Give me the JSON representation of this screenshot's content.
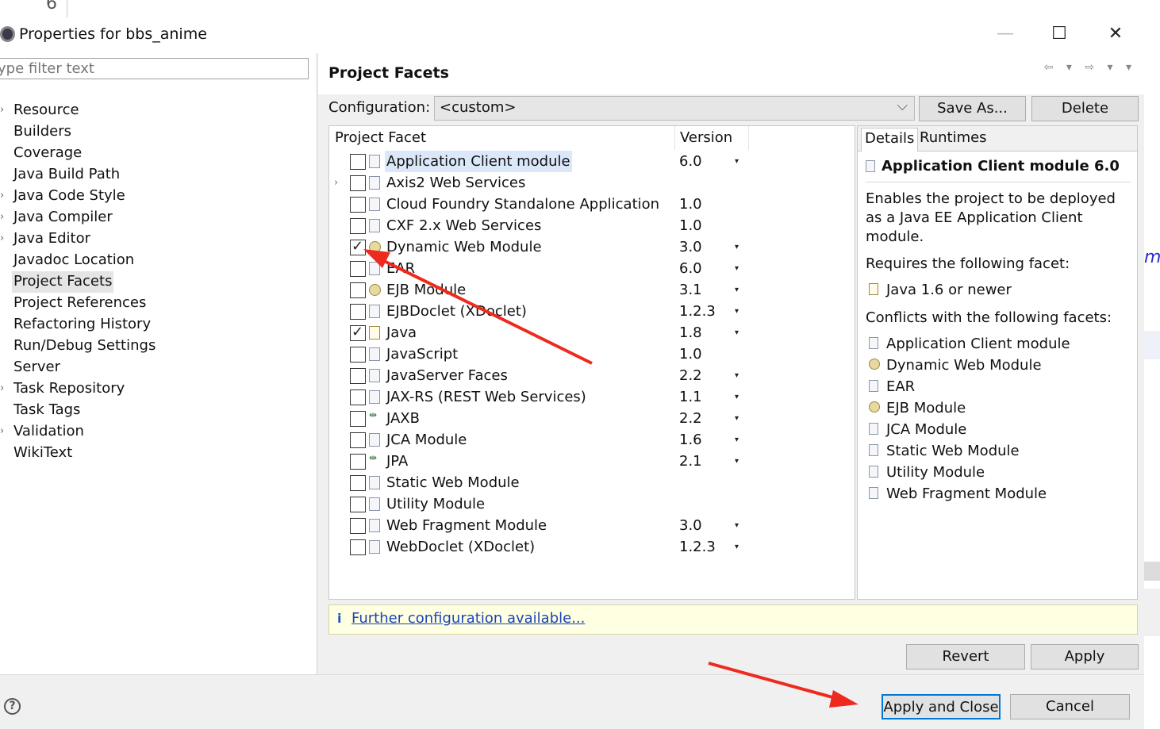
{
  "background": {
    "editor_line_number": "6",
    "editor_fragment": "mp"
  },
  "dialog": {
    "title": "Properties for bbs_anime",
    "minimize_glyph": "—",
    "maximize_glyph": "☐",
    "close_glyph": "✕"
  },
  "filter": {
    "placeholder": "type filter text",
    "shown_text": "ype filter text"
  },
  "tree": {
    "items": [
      {
        "label": "Resource",
        "expandable": true
      },
      {
        "label": "Builders",
        "expandable": false
      },
      {
        "label": "Coverage",
        "expandable": false
      },
      {
        "label": "Java Build Path",
        "expandable": false
      },
      {
        "label": "Java Code Style",
        "expandable": true
      },
      {
        "label": "Java Compiler",
        "expandable": true
      },
      {
        "label": "Java Editor",
        "expandable": true
      },
      {
        "label": "Javadoc Location",
        "expandable": false
      },
      {
        "label": "Project Facets",
        "expandable": false,
        "selected": true
      },
      {
        "label": "Project References",
        "expandable": false
      },
      {
        "label": "Refactoring History",
        "expandable": false
      },
      {
        "label": "Run/Debug Settings",
        "expandable": false
      },
      {
        "label": "Server",
        "expandable": false
      },
      {
        "label": "Task Repository",
        "expandable": true
      },
      {
        "label": "Task Tags",
        "expandable": false
      },
      {
        "label": "Validation",
        "expandable": true
      },
      {
        "label": "WikiText",
        "expandable": false
      }
    ]
  },
  "page": {
    "title": "Project Facets",
    "nav_icons": "⇦ ▾ ⇨ ▾ ▾",
    "configuration_label": "Configuration:",
    "configuration_value": "<custom>",
    "save_as_label": "Save As...",
    "delete_label": "Delete"
  },
  "facets": {
    "header_facet": "Project Facet",
    "header_version": "Version",
    "rows": [
      {
        "name": "Application Client module",
        "version": "6.0",
        "checked": false,
        "dropdown": true,
        "selected": true,
        "icon": "page"
      },
      {
        "name": "Axis2 Web Services",
        "version": "",
        "checked": false,
        "dropdown": false,
        "expandable": true,
        "icon": "page"
      },
      {
        "name": "Cloud Foundry Standalone Application",
        "version": "1.0",
        "checked": false,
        "dropdown": false,
        "icon": "page"
      },
      {
        "name": "CXF 2.x Web Services",
        "version": "1.0",
        "checked": false,
        "dropdown": false,
        "icon": "page"
      },
      {
        "name": "Dynamic Web Module",
        "version": "3.0",
        "checked": true,
        "dropdown": true,
        "icon": "globe"
      },
      {
        "name": "EAR",
        "version": "6.0",
        "checked": false,
        "dropdown": true,
        "icon": "page"
      },
      {
        "name": "EJB Module",
        "version": "3.1",
        "checked": false,
        "dropdown": true,
        "icon": "globe"
      },
      {
        "name": "EJBDoclet (XDoclet)",
        "version": "1.2.3",
        "checked": false,
        "dropdown": true,
        "icon": "page"
      },
      {
        "name": "Java",
        "version": "1.8",
        "checked": true,
        "dropdown": true,
        "icon": "java"
      },
      {
        "name": "JavaScript",
        "version": "1.0",
        "checked": false,
        "dropdown": false,
        "icon": "page"
      },
      {
        "name": "JavaServer Faces",
        "version": "2.2",
        "checked": false,
        "dropdown": true,
        "icon": "page"
      },
      {
        "name": "JAX-RS (REST Web Services)",
        "version": "1.1",
        "checked": false,
        "dropdown": true,
        "icon": "page"
      },
      {
        "name": "JAXB",
        "version": "2.2",
        "checked": false,
        "dropdown": true,
        "icon": "jaxb"
      },
      {
        "name": "JCA Module",
        "version": "1.6",
        "checked": false,
        "dropdown": true,
        "icon": "page"
      },
      {
        "name": "JPA",
        "version": "2.1",
        "checked": false,
        "dropdown": true,
        "icon": "jaxb"
      },
      {
        "name": "Static Web Module",
        "version": "",
        "checked": false,
        "dropdown": false,
        "icon": "page"
      },
      {
        "name": "Utility Module",
        "version": "",
        "checked": false,
        "dropdown": false,
        "icon": "page"
      },
      {
        "name": "Web Fragment Module",
        "version": "3.0",
        "checked": false,
        "dropdown": true,
        "icon": "page"
      },
      {
        "name": "WebDoclet (XDoclet)",
        "version": "1.2.3",
        "checked": false,
        "dropdown": true,
        "icon": "page"
      }
    ]
  },
  "details": {
    "tab_details": "Details",
    "tab_runtimes": "Runtimes",
    "title": "Application Client module 6.0",
    "description": "Enables the project to be deployed as a Java EE Application Client module.",
    "requires_label": "Requires the following facet:",
    "requires": [
      {
        "name": "Java 1.6 or newer",
        "icon": "java"
      }
    ],
    "conflicts_label": "Conflicts with the following facets:",
    "conflicts": [
      {
        "name": "Application Client module",
        "icon": "page"
      },
      {
        "name": "Dynamic Web Module",
        "icon": "globe"
      },
      {
        "name": "EAR",
        "icon": "page"
      },
      {
        "name": "EJB Module",
        "icon": "globe"
      },
      {
        "name": "JCA Module",
        "icon": "page"
      },
      {
        "name": "Static Web Module",
        "icon": "page"
      },
      {
        "name": "Utility Module",
        "icon": "page"
      },
      {
        "name": "Web Fragment Module",
        "icon": "page"
      }
    ]
  },
  "info": {
    "icon": "i",
    "link": "Further configuration available..."
  },
  "buttons": {
    "revert": "Revert",
    "apply": "Apply",
    "apply_and_close": "Apply and Close",
    "cancel": "Cancel",
    "help": "?"
  },
  "colors": {
    "annotation_arrow": "#ee2a1f",
    "default_button_border": "#0078d7"
  }
}
